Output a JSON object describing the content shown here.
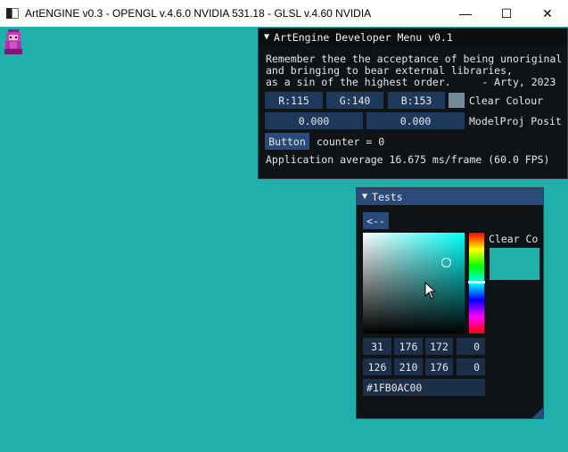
{
  "window": {
    "title": "ArtENGINE v0.3 - OPENGL v.4.6.0 NVIDIA 531.18 - GLSL v.4.60 NVIDIA",
    "minimize": "—",
    "maximize": "☐",
    "close": "✕"
  },
  "dev_menu": {
    "title": "ArtEngine Developer Menu v0.1",
    "quote": [
      "Remember thee the acceptance of being unoriginal",
      "and bringing to bear external libraries,",
      "as a sin of the highest order.     - Arty, 2023"
    ],
    "color_r": "R:115",
    "color_g": "G:140",
    "color_b": "B:153",
    "color_swatch": "#738c99",
    "clear_colour_label": "Clear Colour",
    "pos_x": "0.000",
    "pos_y": "0.000",
    "pos_label": "ModelProj Posit",
    "button_label": "Button",
    "counter_text": "counter = 0",
    "fps_text": "Application average 16.675 ms/frame (60.0 FPS)"
  },
  "tests": {
    "title": "Tests",
    "back_button": "<--",
    "picker_label": "Clear Co",
    "picker_color": "#1fb0ac",
    "hue_color": "#00fffb",
    "row1": [
      "31",
      "176",
      "172",
      "0"
    ],
    "row2": [
      "126",
      "210",
      "176",
      "0"
    ],
    "hex": "#1FB0AC00"
  },
  "colors": {
    "background": "#1fb0ac",
    "imgui_button": "#1d3a5c",
    "imgui_header": "#294a7a"
  }
}
